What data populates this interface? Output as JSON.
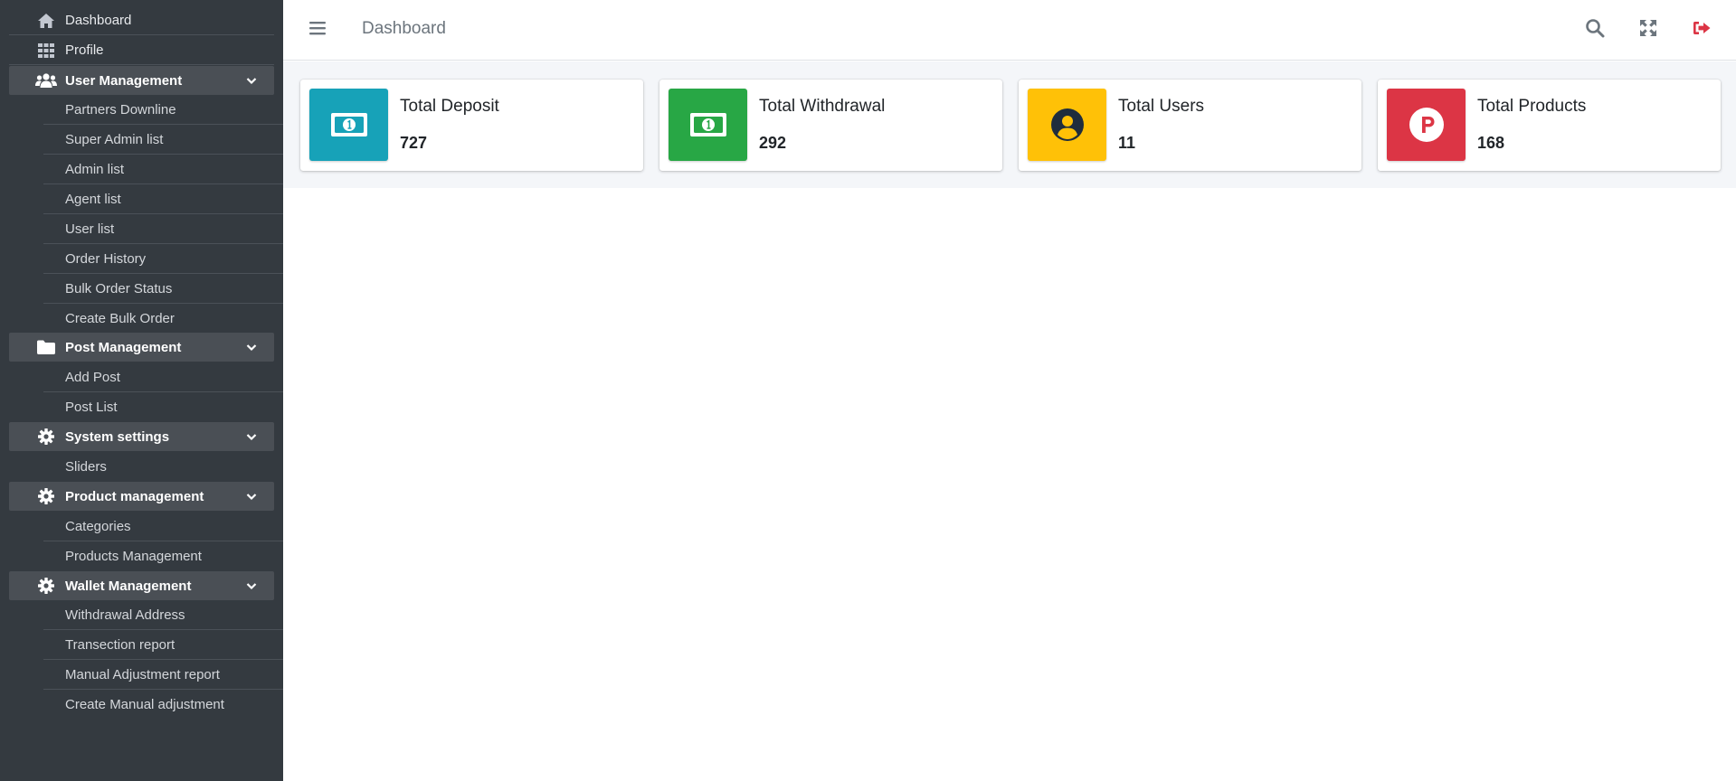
{
  "sidebar": {
    "items": [
      {
        "label": "Dashboard",
        "icon": "home-icon"
      },
      {
        "label": "Profile",
        "icon": "grid-icon"
      },
      {
        "label": "User Management",
        "icon": "users-icon"
      },
      {
        "label": "Partners Downline"
      },
      {
        "label": "Super Admin list"
      },
      {
        "label": "Admin list"
      },
      {
        "label": "Agent list"
      },
      {
        "label": "User list"
      },
      {
        "label": "Order History"
      },
      {
        "label": "Bulk Order Status"
      },
      {
        "label": "Create Bulk Order"
      },
      {
        "label": "Post Management",
        "icon": "folder-icon"
      },
      {
        "label": "Add Post"
      },
      {
        "label": "Post List"
      },
      {
        "label": "System settings",
        "icon": "gear-icon"
      },
      {
        "label": "Sliders"
      },
      {
        "label": "Product management",
        "icon": "gear-icon"
      },
      {
        "label": "Categories"
      },
      {
        "label": "Products Management"
      },
      {
        "label": "Wallet Management",
        "icon": "gear-icon"
      },
      {
        "label": "Withdrawal Address"
      },
      {
        "label": "Transection report"
      },
      {
        "label": "Manual Adjustment report"
      },
      {
        "label": "Create Manual adjustment"
      }
    ]
  },
  "header": {
    "title": "Dashboard",
    "icons": [
      "menu-icon",
      "search-icon",
      "expand-icon",
      "logout-icon"
    ]
  },
  "cards": [
    {
      "label": "Total Deposit",
      "value": "727",
      "color": "#17a2b8",
      "icon": "money-bill-icon"
    },
    {
      "label": "Total Withdrawal",
      "value": "292",
      "color": "#28a745",
      "icon": "money-bill-icon"
    },
    {
      "label": "Total Users",
      "value": "11",
      "color": "#ffc107",
      "icon": "user-circle-icon"
    },
    {
      "label": "Total Products",
      "value": "168",
      "color": "#dc3545",
      "icon": "product-hunt-icon"
    }
  ],
  "colors": {
    "sidebar_bg": "#343a40",
    "logout_icon": "#dc3545"
  }
}
